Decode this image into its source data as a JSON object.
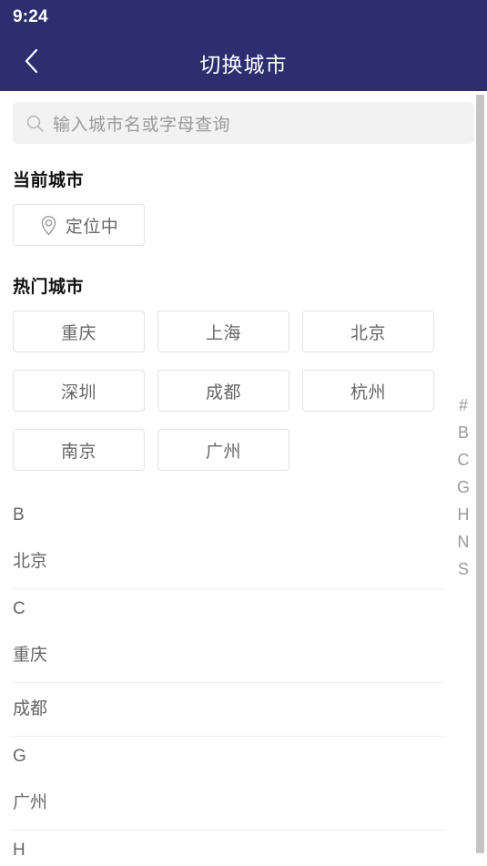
{
  "status_bar": {
    "time": "9:24"
  },
  "nav": {
    "back_icon": "chevron-left-icon",
    "title": "切换城市",
    "background_color": "#2c2e70"
  },
  "search": {
    "icon": "search-icon",
    "placeholder": "输入城市名或字母查询",
    "value": ""
  },
  "current_city": {
    "heading": "当前城市",
    "button": {
      "icon": "map-pin-icon",
      "label": "定位中"
    }
  },
  "hot_cities": {
    "heading": "热门城市",
    "items": [
      {
        "label": "重庆"
      },
      {
        "label": "上海"
      },
      {
        "label": "北京"
      },
      {
        "label": "深圳"
      },
      {
        "label": "成都"
      },
      {
        "label": "杭州"
      },
      {
        "label": "南京"
      },
      {
        "label": "广州"
      }
    ]
  },
  "city_list": {
    "groups": [
      {
        "letter": "B",
        "cities": [
          "北京"
        ]
      },
      {
        "letter": "C",
        "cities": [
          "重庆",
          "成都"
        ]
      },
      {
        "letter": "G",
        "cities": [
          "广州"
        ]
      },
      {
        "letter": "H",
        "cities": []
      }
    ]
  },
  "index_strip": {
    "letters": [
      "#",
      "B",
      "C",
      "G",
      "H",
      "N",
      "S"
    ]
  },
  "colors": {
    "header": "#2c2e70",
    "search_field": "#f2f2f2",
    "text_secondary": "#666666",
    "border": "#e2e2e2",
    "divider": "#ededed",
    "scrollbar": "#c4c4c4"
  }
}
